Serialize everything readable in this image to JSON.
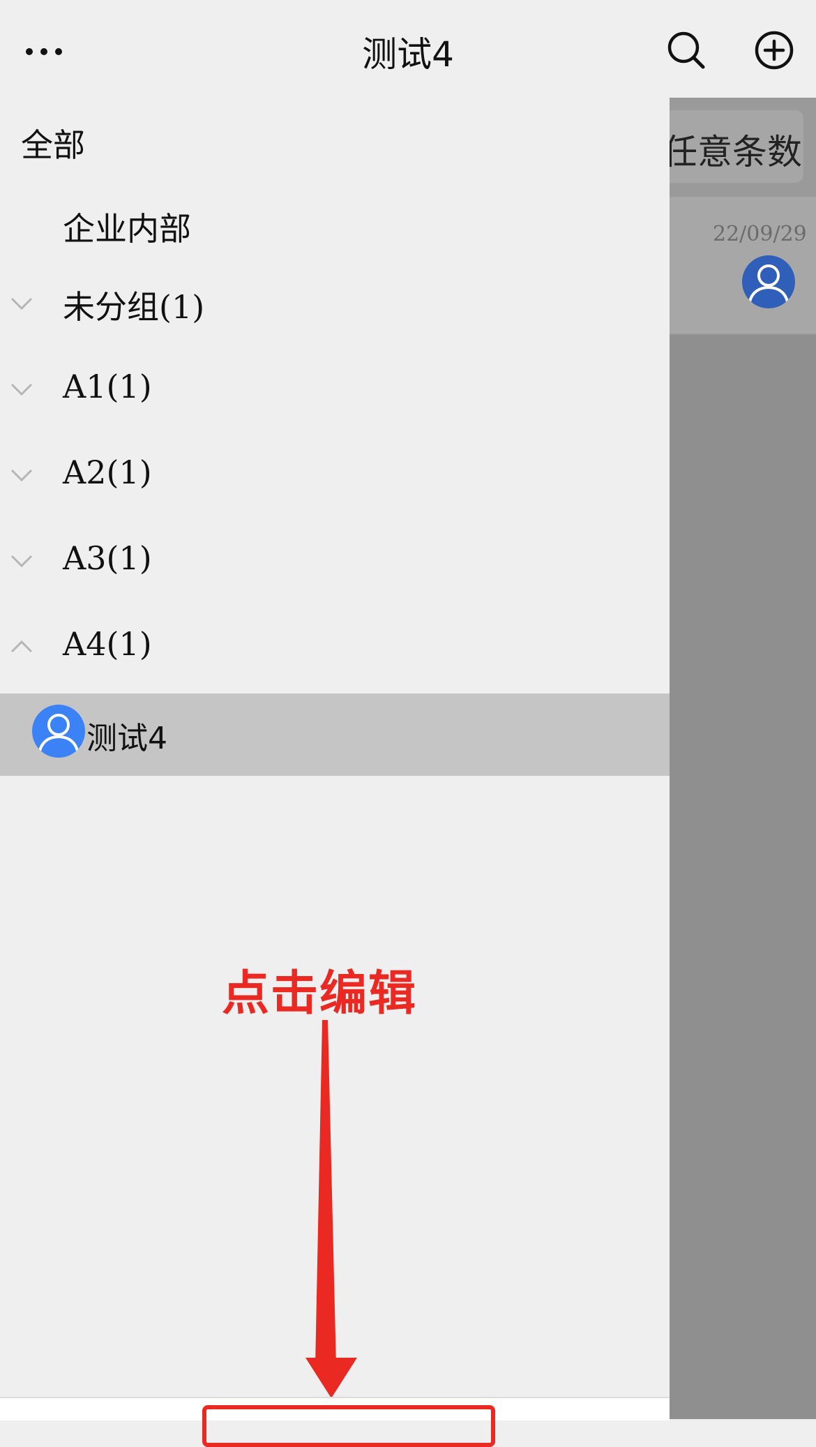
{
  "header": {
    "title": "测试4",
    "icons": [
      "more-icon",
      "search-icon",
      "add-circle-icon"
    ]
  },
  "background_panel": {
    "tab_label": "任意条数",
    "row_date": "22/09/29"
  },
  "drawer": {
    "root_label": "全部",
    "sub_label": "企业内部",
    "groups": [
      {
        "label": "未分组(1)",
        "expanded": false
      },
      {
        "label": "A1(1)",
        "expanded": false
      },
      {
        "label": "A2(1)",
        "expanded": false
      },
      {
        "label": "A3(1)",
        "expanded": false
      },
      {
        "label": "A4(1)",
        "expanded": true
      }
    ],
    "selected_member": {
      "name": "测试4"
    }
  },
  "annotation": {
    "text": "点击编辑",
    "color": "#ea2a22"
  },
  "colors": {
    "avatar_blue": "#3b82f6",
    "selected_row": "#c5c5c6",
    "dim_overlay": "#8f8f8f"
  }
}
